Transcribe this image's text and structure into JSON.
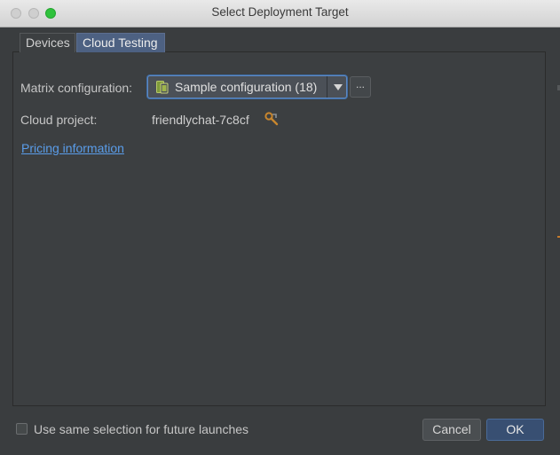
{
  "window": {
    "title": "Select Deployment Target"
  },
  "tabs": [
    {
      "label": "Devices",
      "selected": false
    },
    {
      "label": "Cloud Testing",
      "selected": true
    }
  ],
  "form": {
    "matrix_label": "Matrix configuration:",
    "matrix_value": "Sample configuration (18)",
    "more_button_label": "...",
    "project_label": "Cloud project:",
    "project_value": "friendlychat-7c8cf",
    "pricing_link": "Pricing information"
  },
  "footer": {
    "checkbox_label": "Use same selection for future launches",
    "checkbox_checked": false,
    "cancel_label": "Cancel",
    "ok_label": "OK"
  },
  "colors": {
    "background": "#3c3f41",
    "selected_tab": "#4d6182",
    "link": "#5a9dea",
    "focus_border": "#5e89c2",
    "default_button": "#384f72"
  }
}
